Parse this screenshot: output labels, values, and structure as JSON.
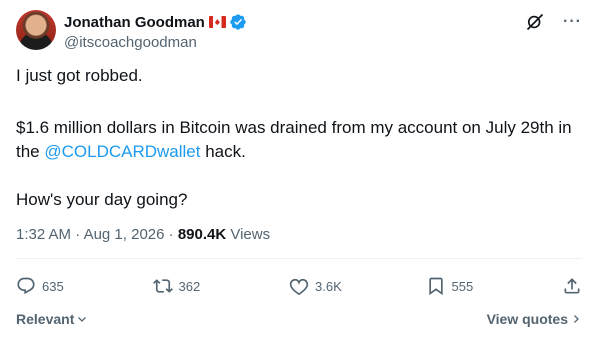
{
  "author": {
    "name": "Jonathan Goodman",
    "handle": "@itscoachgoodman"
  },
  "tweet": {
    "line1": "I just got robbed.",
    "line2_before": "$1.6 million dollars in Bitcoin was drained from my account on July 29th in the ",
    "mention": "@COLDCARDwallet",
    "line2_after": " hack.",
    "line3": "How's your day going?"
  },
  "meta": {
    "time": "1:32 AM",
    "sep": " · ",
    "date": "Aug 1, 2026",
    "views_count": "890.4K",
    "views_label": "Views"
  },
  "actions": {
    "replies": "635",
    "reposts": "362",
    "likes": "3.6K",
    "bookmarks": "555"
  },
  "footer": {
    "sort_label": "Relevant",
    "view_quotes": "View quotes"
  },
  "colors": {
    "accent": "#1d9bf0",
    "text": "#0f1419",
    "muted": "#536471"
  }
}
